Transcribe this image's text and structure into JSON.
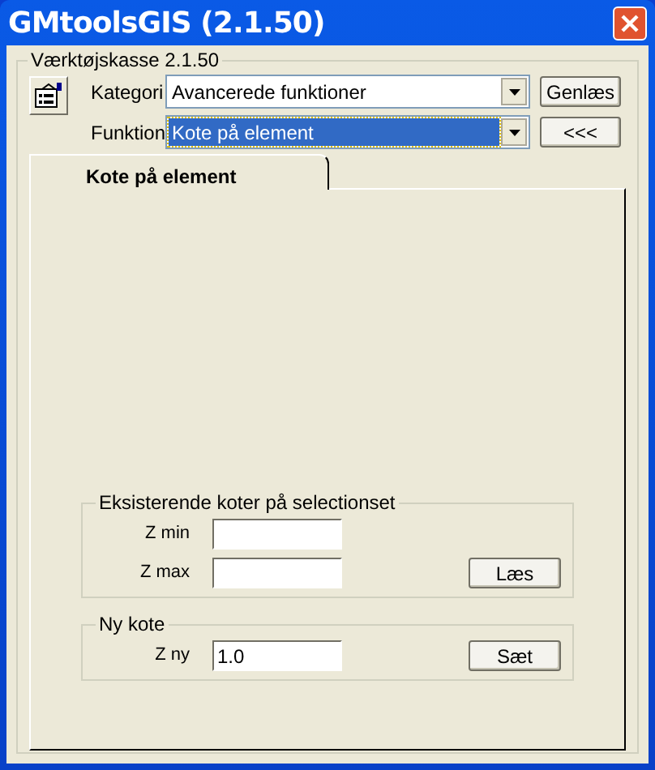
{
  "window": {
    "title": "GMtoolsGIS (2.1.50)"
  },
  "toolbox": {
    "title": "Værktøjskasse 2.1.50",
    "selectors": [
      {
        "label": "Kategori",
        "value": "Avancerede funktioner",
        "focused": false,
        "button": "Genlæs"
      },
      {
        "label": "Funktion",
        "value": "Kote på element",
        "focused": true,
        "button": "<<<"
      }
    ]
  },
  "tabs": [
    {
      "label": "Kote på element",
      "selected": true
    }
  ],
  "groups": [
    {
      "title": "Eksisterende koter på selectionset",
      "fields": [
        {
          "label": "Z min"
        },
        {
          "label": "Z max",
          "button": "Læs"
        }
      ]
    },
    {
      "title": "Ny kote",
      "fields": [
        {
          "label": "Z ny",
          "value": "1.0",
          "button": "Sæt"
        }
      ]
    }
  ]
}
